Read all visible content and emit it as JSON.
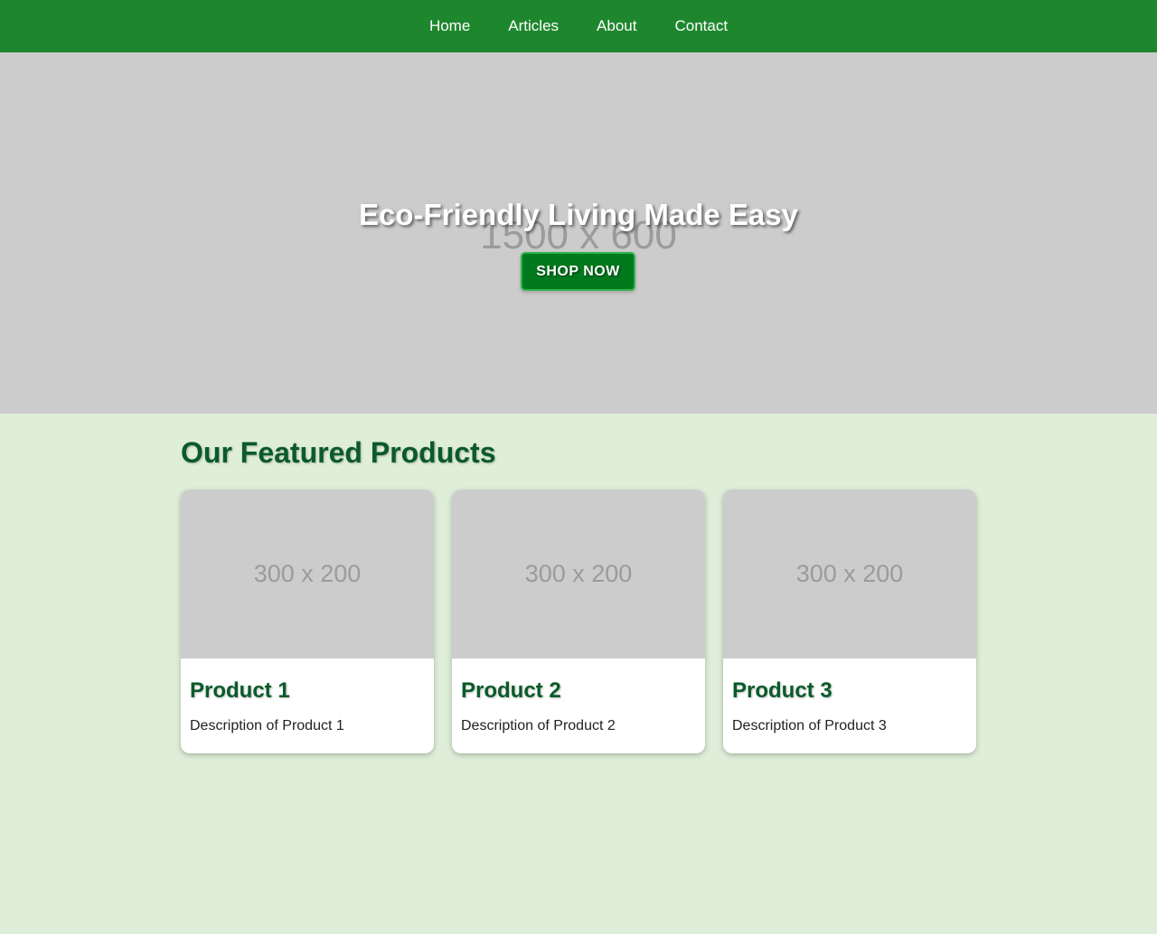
{
  "nav": {
    "links": [
      "Home",
      "Articles",
      "About",
      "Contact"
    ]
  },
  "hero": {
    "placeholder_text": "1500 x 600",
    "title": "Eco-Friendly Living Made Easy",
    "button_label": "SHOP NOW"
  },
  "featured": {
    "title": "Our Featured Products",
    "products": [
      {
        "image_text": "300 x 200",
        "name": "Product 1",
        "description": "Description of Product 1"
      },
      {
        "image_text": "300 x 200",
        "name": "Product 2",
        "description": "Description of Product 2"
      },
      {
        "image_text": "300 x 200",
        "name": "Product 3",
        "description": "Description of Product 3"
      }
    ]
  },
  "colors": {
    "nav_background": "#1e872d",
    "page_background": "#dfeed8",
    "heading_green": "#0a5a2a",
    "button_green": "#007a1d",
    "placeholder_gray": "#cccccc"
  }
}
